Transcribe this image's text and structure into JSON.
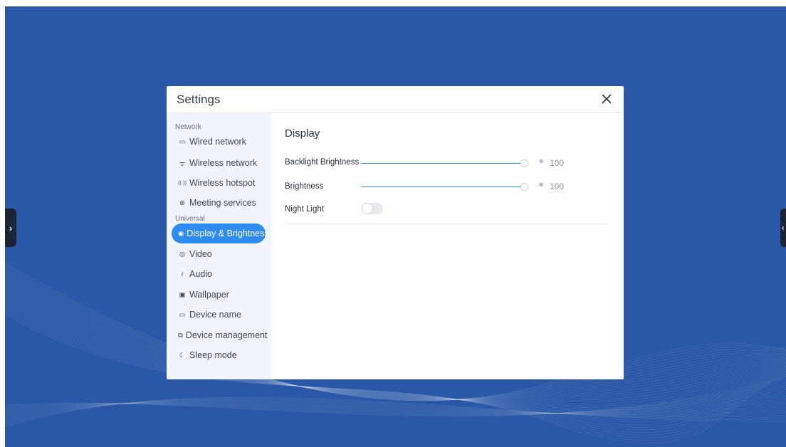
{
  "dialog": {
    "title": "Settings",
    "close_glyph": "✕"
  },
  "sidebar": {
    "sections": [
      {
        "label": "Network"
      },
      {
        "label": "Universal"
      }
    ],
    "items": [
      {
        "label": "Wired network",
        "icon": "wired-network-icon",
        "glyph": "▭"
      },
      {
        "label": "Wireless network",
        "icon": "wifi-icon",
        "glyph": "ᯤ"
      },
      {
        "label": "Wireless hotspot",
        "icon": "hotspot-icon",
        "glyph": "((·))"
      },
      {
        "label": "Meeting services",
        "icon": "globe-icon",
        "glyph": "⊕"
      },
      {
        "label": "Display & Brightness",
        "icon": "eye-icon",
        "glyph": "◉"
      },
      {
        "label": "Video",
        "icon": "camera-icon",
        "glyph": "◎"
      },
      {
        "label": "Audio",
        "icon": "audio-wave-icon",
        "glyph": "≀"
      },
      {
        "label": "Wallpaper",
        "icon": "image-icon",
        "glyph": "▣"
      },
      {
        "label": "Device name",
        "icon": "monitor-icon",
        "glyph": "▭"
      },
      {
        "label": "Device management",
        "icon": "devices-icon",
        "glyph": "⧉"
      },
      {
        "label": "Sleep mode",
        "icon": "moon-icon",
        "glyph": "☾"
      }
    ],
    "active_item": "Display & Brightness"
  },
  "content": {
    "title": "Display",
    "backlight": {
      "label": "Backlight Brightness",
      "value": "100",
      "level": 1.0
    },
    "brightness": {
      "label": "Brightness",
      "value": "100",
      "level": 1.0
    },
    "night_light": {
      "label": "Night Light",
      "enabled": false
    }
  },
  "edge_tabs": {
    "left_glyph": "›",
    "right_glyph": "‹"
  },
  "colors": {
    "desktop": "#2a58a6",
    "accent": "#2e8bf0",
    "sidebar": "#f1f4fa"
  }
}
